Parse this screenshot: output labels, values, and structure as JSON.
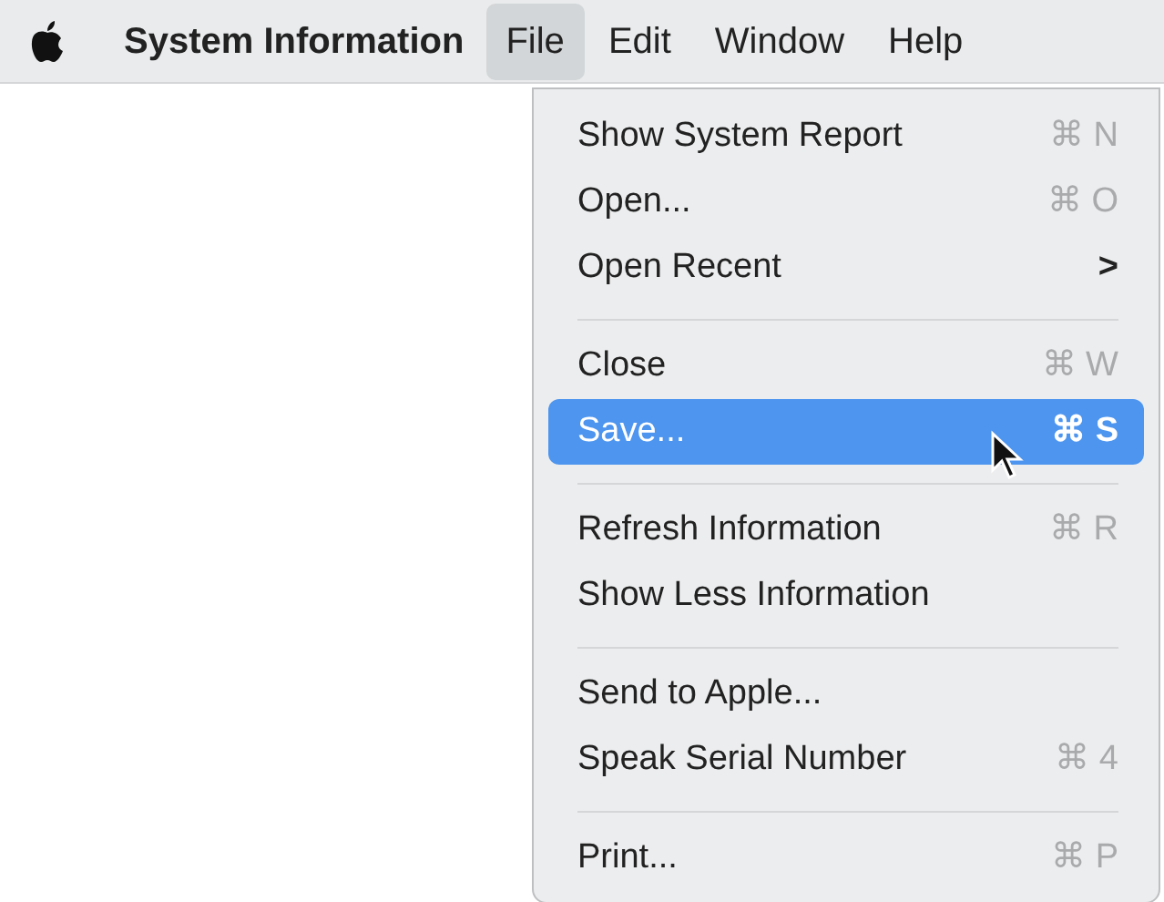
{
  "menu_bar": {
    "app_name": "System Information",
    "menus": [
      {
        "label": "File",
        "selected": true
      },
      {
        "label": "Edit",
        "selected": false
      },
      {
        "label": "Window",
        "selected": false
      },
      {
        "label": "Help",
        "selected": false
      }
    ]
  },
  "file_menu": {
    "items": [
      {
        "kind": "item",
        "label": "Show System Report",
        "shortcut": "⌘ N",
        "selected": false
      },
      {
        "kind": "item",
        "label": "Open...",
        "shortcut": "⌘ O",
        "selected": false
      },
      {
        "kind": "submenu",
        "label": "Open Recent",
        "arrow": ">",
        "selected": false
      },
      {
        "kind": "separator"
      },
      {
        "kind": "item",
        "label": "Close",
        "shortcut": "⌘ W",
        "selected": false
      },
      {
        "kind": "item",
        "label": "Save...",
        "shortcut": "⌘ S",
        "selected": true
      },
      {
        "kind": "separator"
      },
      {
        "kind": "item",
        "label": "Refresh Information",
        "shortcut": "⌘ R",
        "selected": false
      },
      {
        "kind": "item",
        "label": "Show Less Information",
        "selected": false
      },
      {
        "kind": "separator"
      },
      {
        "kind": "item",
        "label": "Send to Apple...",
        "selected": false
      },
      {
        "kind": "item",
        "label": "Speak Serial Number",
        "shortcut": "⌘ 4",
        "selected": false
      },
      {
        "kind": "separator"
      },
      {
        "kind": "item",
        "label": "Print...",
        "shortcut": "⌘ P",
        "selected": false
      }
    ]
  }
}
